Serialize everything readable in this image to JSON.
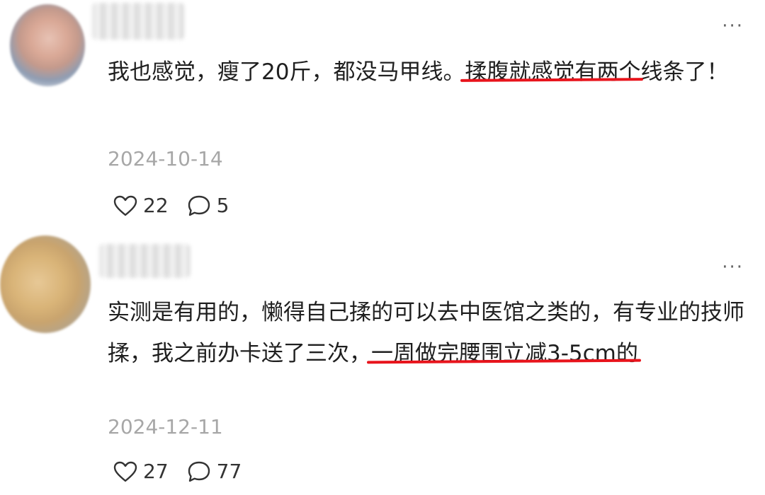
{
  "comments": [
    {
      "author_avatar": "blurred-avatar",
      "author_name": "",
      "text_before": "我也感觉，瘦了20斤，都没马甲线。",
      "text_underlined": "揉腹就感觉有两个",
      "text_after": "线条了！",
      "date": "2024-10-14",
      "likes": "22",
      "replies": "5",
      "more_label": "···"
    },
    {
      "author_avatar": "blurred-avatar",
      "author_name": "",
      "text_before": "实测是有用的，懒得自己揉的可以去中医馆之类的，有专业的技师揉，我之前办卡送了三次，",
      "text_underlined": "一周做完腰围立减3-5cm的",
      "text_after": "",
      "date": "2024-12-11",
      "likes": "27",
      "replies": "77",
      "more_label": "···"
    }
  ],
  "colors": {
    "underline": "#e8141c",
    "date": "#a7a7a7",
    "text": "#1f1f1f"
  },
  "icons": {
    "like": "heart-outline-icon",
    "reply": "speech-bubble-icon",
    "more": "ellipsis-icon"
  }
}
